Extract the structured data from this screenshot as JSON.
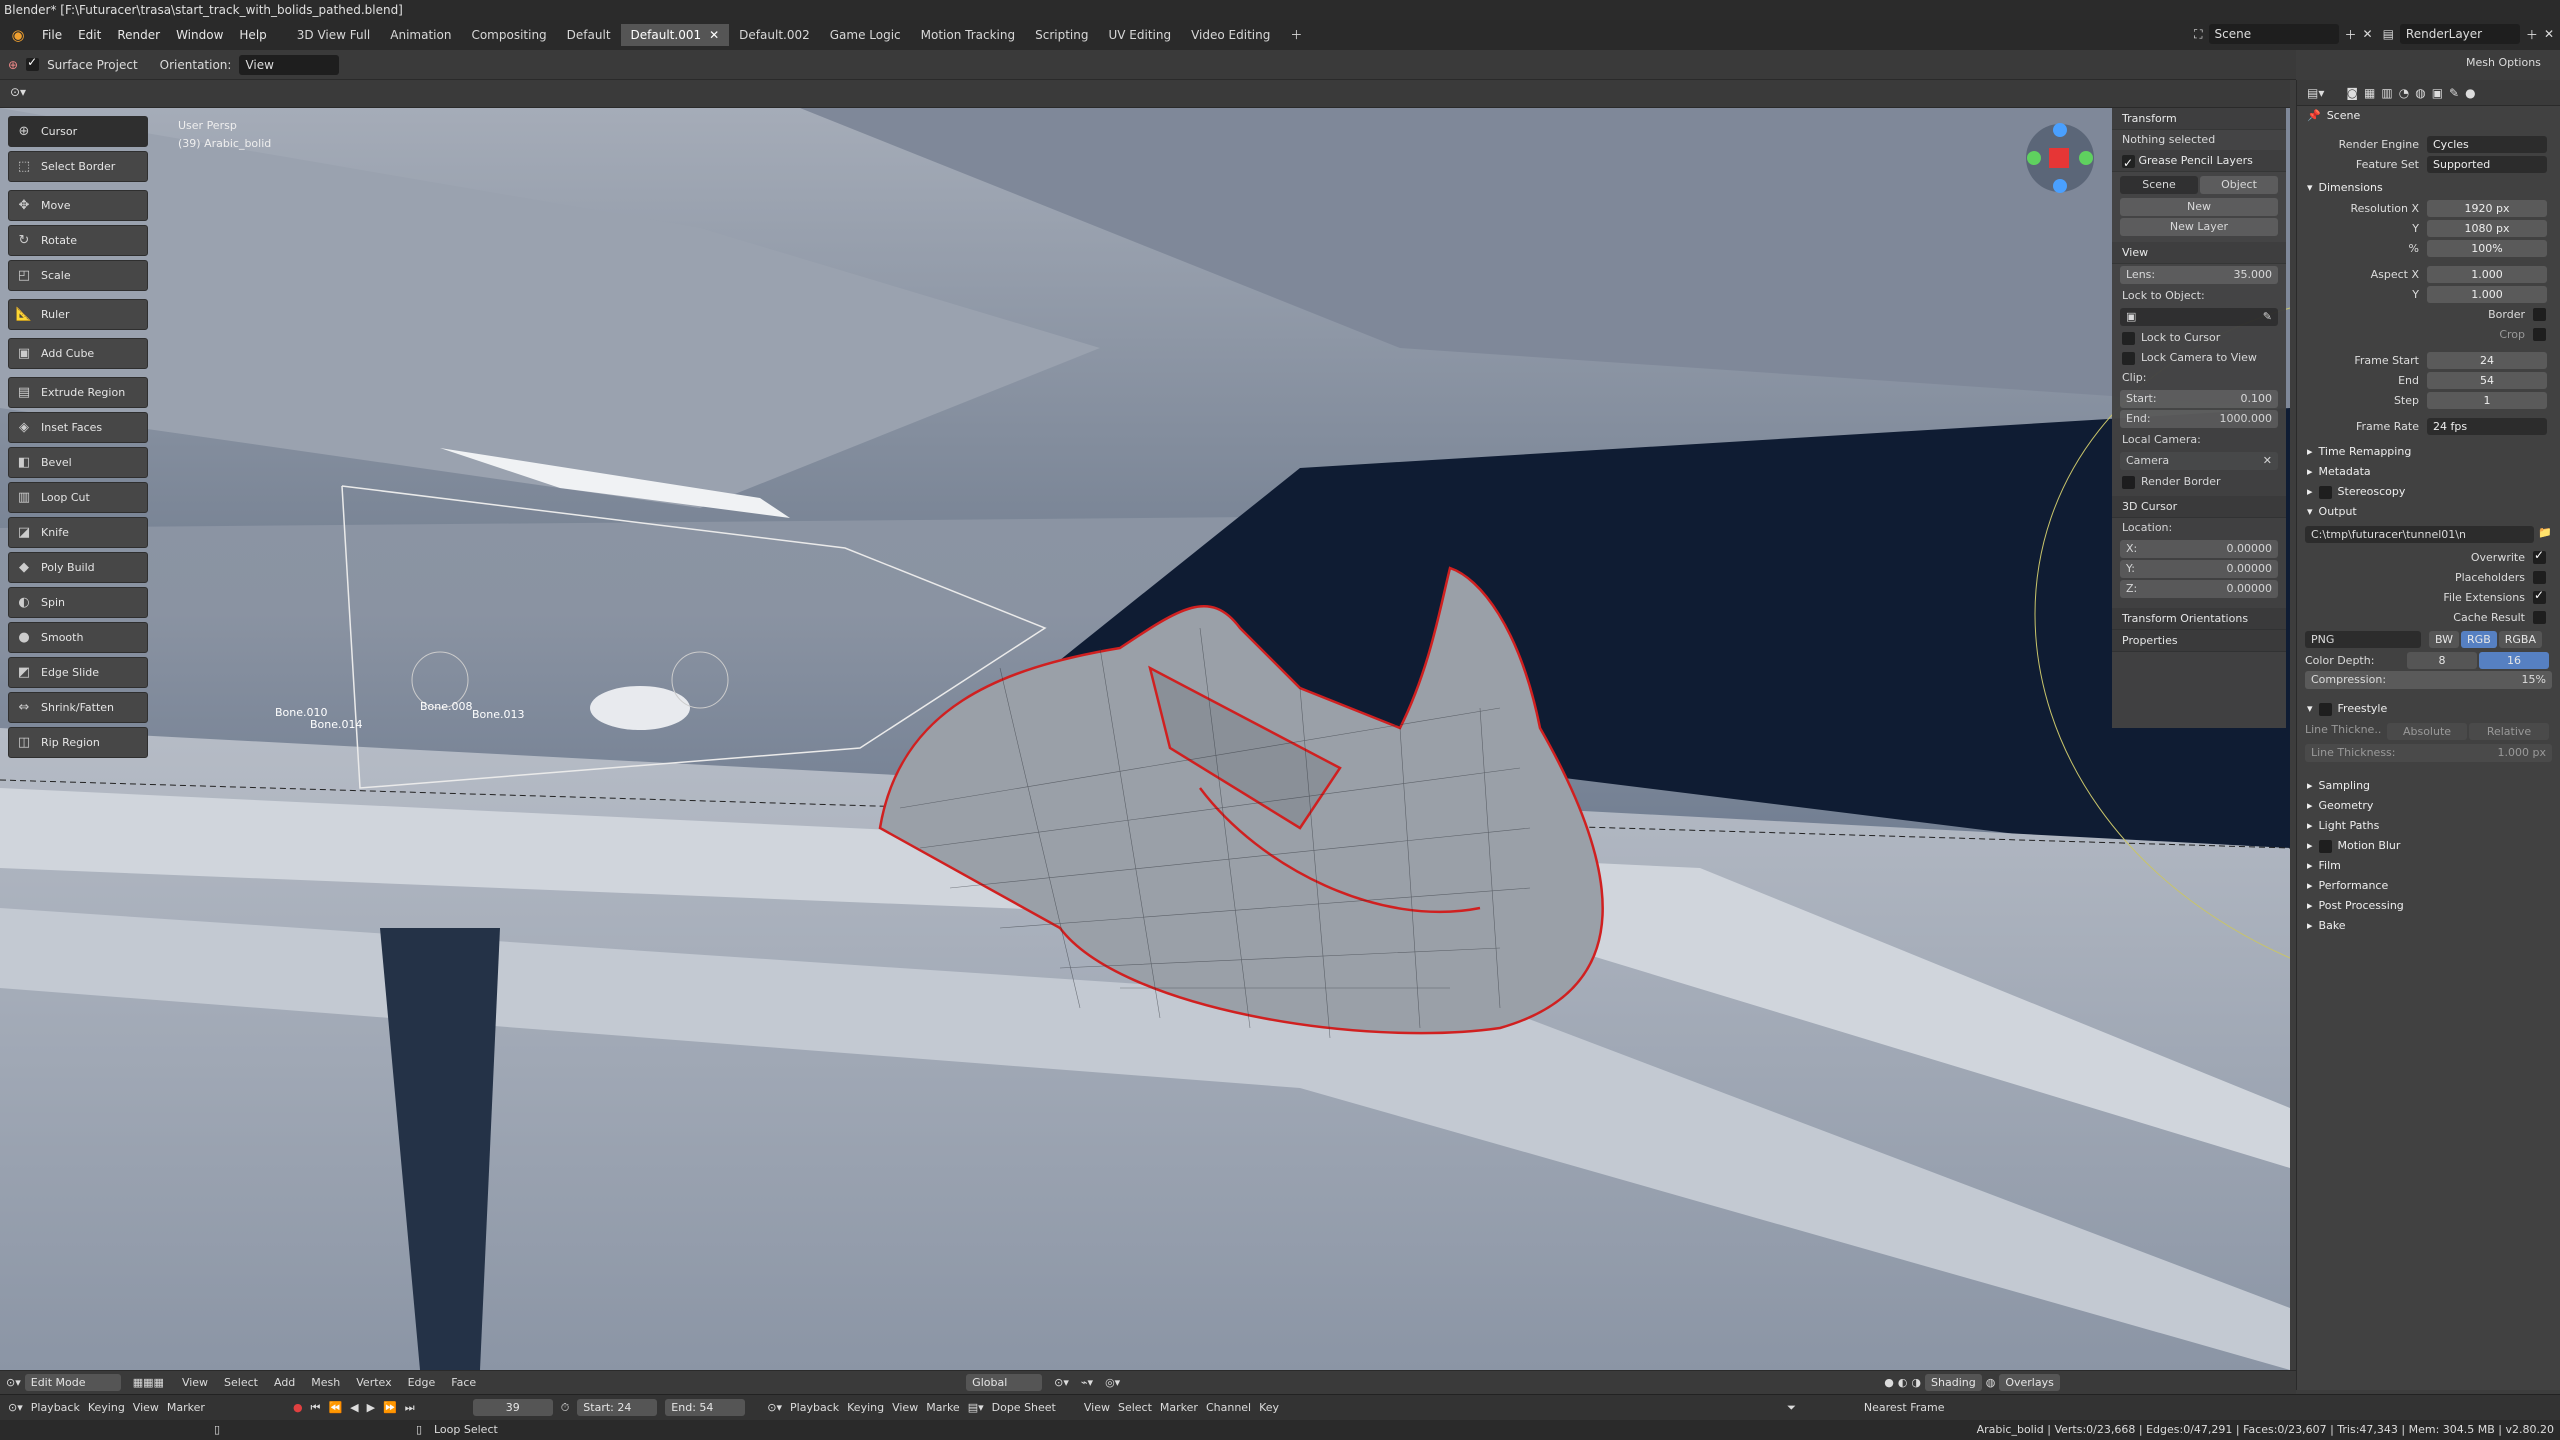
{
  "window": {
    "title": "Blender* [F:\\Futuracer\\trasa\\start_track_with_bolids_pathed.blend]"
  },
  "menu": {
    "items": [
      "File",
      "Edit",
      "Render",
      "Window",
      "Help"
    ]
  },
  "workspaces": [
    "3D View Full",
    "Animation",
    "Compositing",
    "Default",
    "Default.001",
    "Default.002",
    "Game Logic",
    "Motion Tracking",
    "Scripting",
    "UV Editing",
    "Video Editing"
  ],
  "workspace_active": "Default.001",
  "scene": {
    "name": "Scene",
    "render_layer": "RenderLayer"
  },
  "tool_header": {
    "surface_project": "Surface Project",
    "orientation_label": "Orientation:",
    "orientation_value": "View",
    "mesh_options": "Mesh Options"
  },
  "viewport": {
    "perspective": "User Persp",
    "object": "(39) Arabic_bolid",
    "bone_labels": [
      "Bone.010",
      "Bone.014",
      "Bone.008",
      "Bone.013"
    ]
  },
  "tools": [
    {
      "label": "Cursor",
      "icon": "cursor-icon"
    },
    {
      "label": "Select Border",
      "icon": "select-border-icon"
    },
    {
      "label": "Move",
      "icon": "move-icon"
    },
    {
      "label": "Rotate",
      "icon": "rotate-icon"
    },
    {
      "label": "Scale",
      "icon": "scale-icon"
    },
    {
      "label": "Ruler",
      "icon": "ruler-icon"
    },
    {
      "label": "Add Cube",
      "icon": "add-cube-icon"
    },
    {
      "label": "Extrude Region",
      "icon": "extrude-icon"
    },
    {
      "label": "Inset Faces",
      "icon": "inset-icon"
    },
    {
      "label": "Bevel",
      "icon": "bevel-icon"
    },
    {
      "label": "Loop Cut",
      "icon": "loop-cut-icon"
    },
    {
      "label": "Knife",
      "icon": "knife-icon"
    },
    {
      "label": "Poly Build",
      "icon": "poly-build-icon"
    },
    {
      "label": "Spin",
      "icon": "spin-icon"
    },
    {
      "label": "Smooth",
      "icon": "smooth-icon"
    },
    {
      "label": "Edge Slide",
      "icon": "edge-slide-icon"
    },
    {
      "label": "Shrink/Fatten",
      "icon": "shrink-fatten-icon"
    },
    {
      "label": "Rip Region",
      "icon": "rip-region-icon"
    }
  ],
  "npanel": {
    "transform": "Transform",
    "nothing_selected": "Nothing selected",
    "gp_layers": "Grease Pencil Layers",
    "scene_tab": "Scene",
    "object_tab": "Object",
    "new": "New",
    "new_layer": "New Layer",
    "view": "View",
    "lens_label": "Lens:",
    "lens": "35.000",
    "lock_to_object": "Lock to Object:",
    "lock_cursor": "Lock to Cursor",
    "lock_camera": "Lock Camera to View",
    "clip": "Clip:",
    "clip_start_label": "Start:",
    "clip_start": "0.100",
    "clip_end_label": "End:",
    "clip_end": "1000.000",
    "local_camera": "Local Camera:",
    "camera": "Camera",
    "render_border": "Render Border",
    "cursor_3d": "3D Cursor",
    "location": "Location:",
    "x": "0.00000",
    "y": "0.00000",
    "z": "0.00000",
    "transform_orientations": "Transform Orientations",
    "properties": "Properties"
  },
  "props": {
    "scene": "Scene",
    "render_engine_label": "Render Engine",
    "render_engine": "Cycles",
    "feature_set_label": "Feature Set",
    "feature_set": "Supported",
    "dimensions": "Dimensions",
    "res_x_label": "Resolution X",
    "res_x": "1920 px",
    "res_y_label": "Y",
    "res_y": "1080 px",
    "pct_label": "%",
    "pct": "100%",
    "aspect_x_label": "Aspect X",
    "aspect_x": "1.000",
    "aspect_y_label": "Y",
    "aspect_y": "1.000",
    "border": "Border",
    "crop": "Crop",
    "frame_start_label": "Frame Start",
    "frame_start": "24",
    "end_label": "End",
    "end": "54",
    "step_label": "Step",
    "step": "1",
    "frame_rate_label": "Frame Rate",
    "frame_rate": "24 fps",
    "time_remapping": "Time Remapping",
    "metadata": "Metadata",
    "stereoscopy": "Stereoscopy",
    "output": "Output",
    "output_path": "C:\\tmp\\futuracer\\tunnel01\\n",
    "overwrite": "Overwrite",
    "placeholders": "Placeholders",
    "file_extensions": "File Extensions",
    "cache_result": "Cache Result",
    "format": "PNG",
    "bw": "BW",
    "rgb": "RGB",
    "rgba": "RGBA",
    "color_depth_label": "Color Depth:",
    "depth8": "8",
    "depth16": "16",
    "compression_label": "Compression:",
    "compression": "15%",
    "freestyle": "Freestyle",
    "line_thickness_mode": "Line Thickne..",
    "absolute": "Absolute",
    "relative": "Relative",
    "line_thickness_label": "Line Thickness:",
    "line_thickness": "1.000 px",
    "sections": [
      "Sampling",
      "Geometry",
      "Light Paths",
      "Motion Blur",
      "Film",
      "Performance",
      "Post Processing",
      "Bake"
    ]
  },
  "vp_footer": {
    "mode": "Edit Mode",
    "items": [
      "View",
      "Select",
      "Add",
      "Mesh",
      "Vertex",
      "Edge",
      "Face"
    ],
    "orientation": "Global",
    "shading": "Shading",
    "overlays": "Overlays"
  },
  "timeline": {
    "playback": "Playback",
    "keying": "Keying",
    "view": "View",
    "marker": "Marker",
    "frame": "39",
    "start_label": "Start:",
    "start": "24",
    "end_label": "End:",
    "end": "54",
    "playback2": "Playback",
    "keying2": "Keying",
    "view2": "View",
    "marker2": "Marke",
    "dope_sheet": "Dope Sheet",
    "view3": "View",
    "select": "Select",
    "marker3": "Marker",
    "channel": "Channel",
    "key": "Key",
    "nearest_frame": "Nearest Frame"
  },
  "status": {
    "left": "Loop Select",
    "right": "Arabic_bolid | Verts:0/23,668 | Edges:0/47,291 | Faces:0/23,607 | Tris:47,343 | Mem: 304.5 MB | v2.80.20"
  }
}
